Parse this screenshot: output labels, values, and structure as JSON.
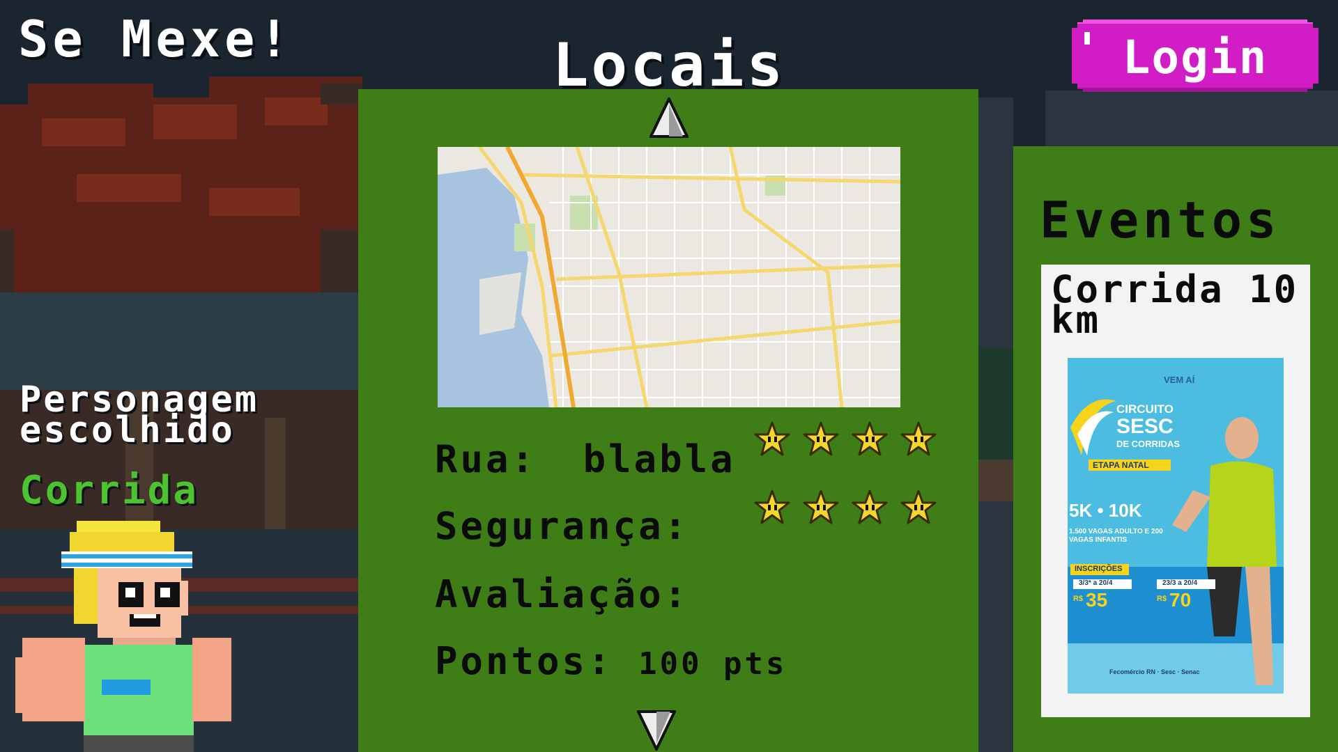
{
  "app": {
    "title": "Se Mexe!"
  },
  "header": {
    "section_title": "Locais",
    "login_label": "Login"
  },
  "character": {
    "heading": "Personagem escolhido",
    "activity": "Corrida"
  },
  "locais": {
    "rua_label": "Rua:",
    "rua_value": "blabla",
    "seguranca_label": "Segurança:",
    "seguranca_rating": 4,
    "avaliacao_label": "Avaliação:",
    "avaliacao_rating": 4,
    "pontos_label": "Pontos:",
    "pontos_value": "100 pts"
  },
  "eventos": {
    "title": "Eventos",
    "event_title": "Corrida 10 km",
    "poster": {
      "vem_ai": "VEM AÍ",
      "circuito": "CIRCUITO",
      "sesc": "SESC",
      "de_corridas": "DE CORRIDAS",
      "etapa": "ETAPA NATAL",
      "distances": "5K • 10K",
      "vagas": "1.500 VAGAS ADULTO E 200 VAGAS INFANTIS",
      "inscricoes": "INSCRIÇÕES",
      "date1": "3/3* a 20/4",
      "price1": "35",
      "date2": "23/3 a 20/4",
      "price2": "70",
      "currency": "R$",
      "footer": "Fecomércio RN · Sesc · Senac"
    }
  },
  "colors": {
    "panel_green": "#3f7d16",
    "login_magenta": "#d21cc6",
    "activity_green": "#4cc430",
    "background": "#1b2530"
  }
}
